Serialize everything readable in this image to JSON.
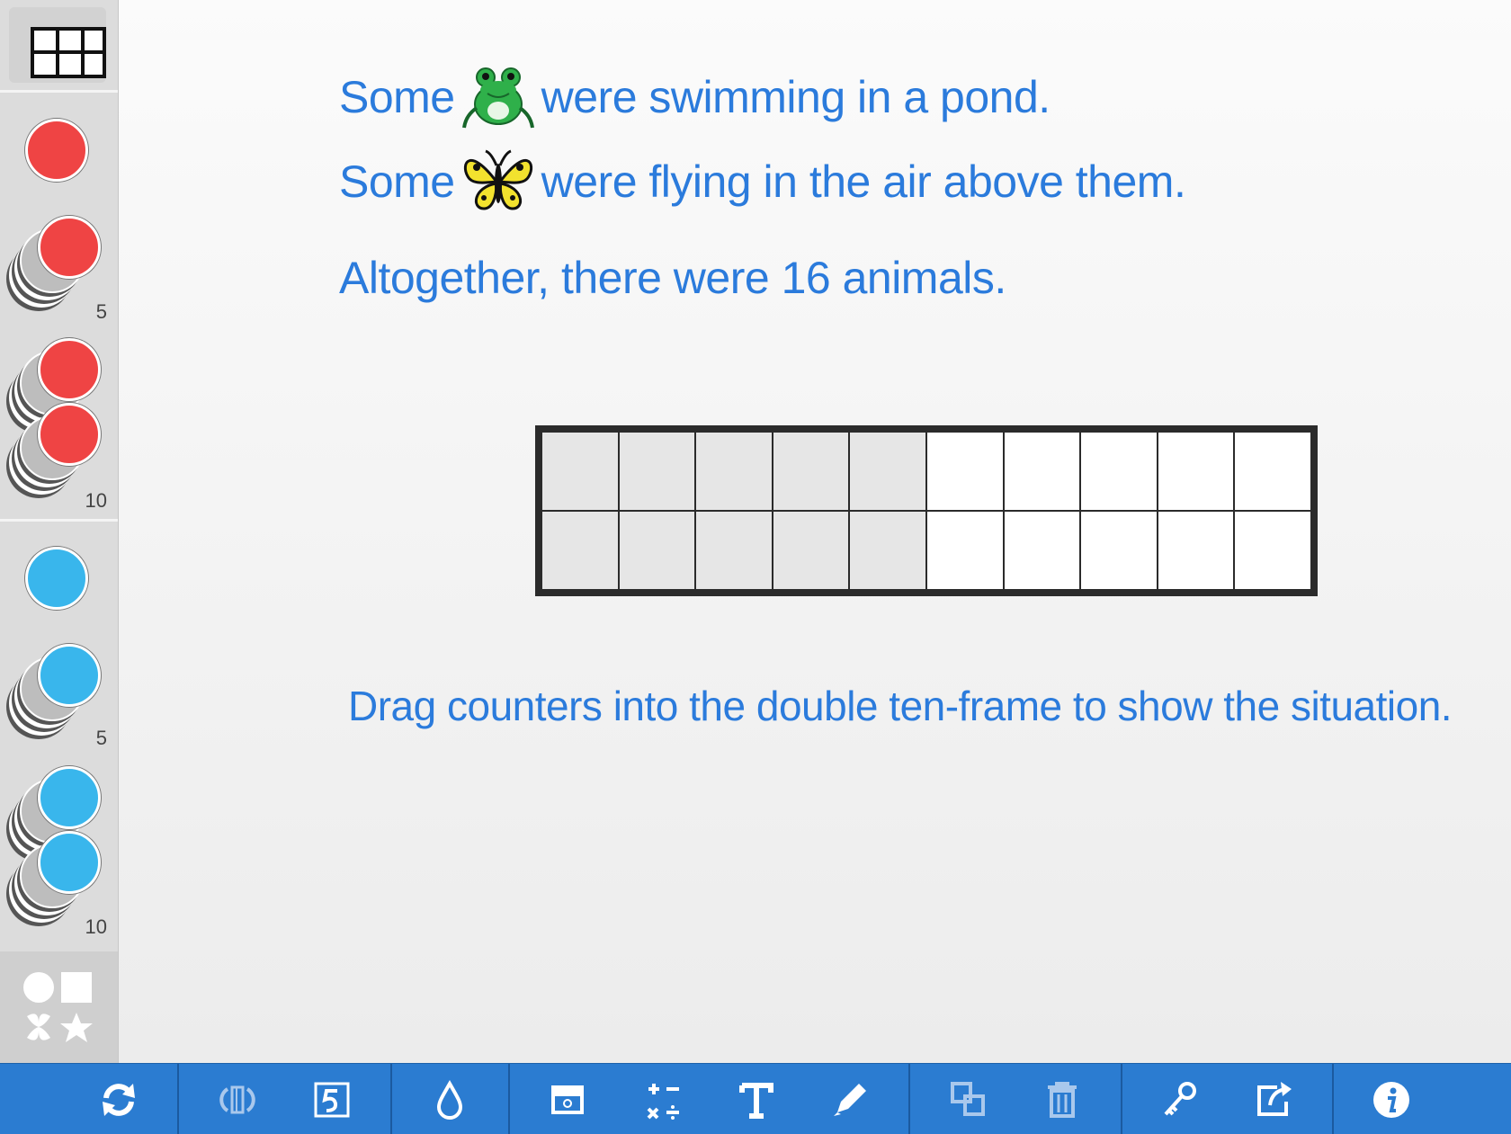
{
  "story": {
    "line1_prefix": "Some",
    "line1_suffix": "were swimming in a pond.",
    "line2_prefix": "Some",
    "line2_suffix": "were flying in the air above them.",
    "line3": "Altogether, there were 16 animals."
  },
  "instruction": "Drag counters into the double ten-frame to show the situation.",
  "sidebar": {
    "red_stack_5_label": "5",
    "red_stack_10_label": "10",
    "blue_stack_5_label": "5",
    "blue_stack_10_label": "10"
  },
  "ten_frame": {
    "columns": 10,
    "rows": 2,
    "shaded_columns": 5
  },
  "colors": {
    "red_counter": "#ef4444",
    "blue_counter": "#39b6ec",
    "text_blue": "#2b7bdc",
    "toolbar": "#2b7cd1"
  },
  "toolbar_icons": [
    "refresh-icon",
    "flip-icon",
    "number-five-icon",
    "color-drop-icon",
    "hide-icon",
    "operations-icon",
    "text-icon",
    "pencil-icon",
    "duplicate-icon",
    "trash-icon",
    "key-icon",
    "share-icon",
    "info-icon"
  ]
}
